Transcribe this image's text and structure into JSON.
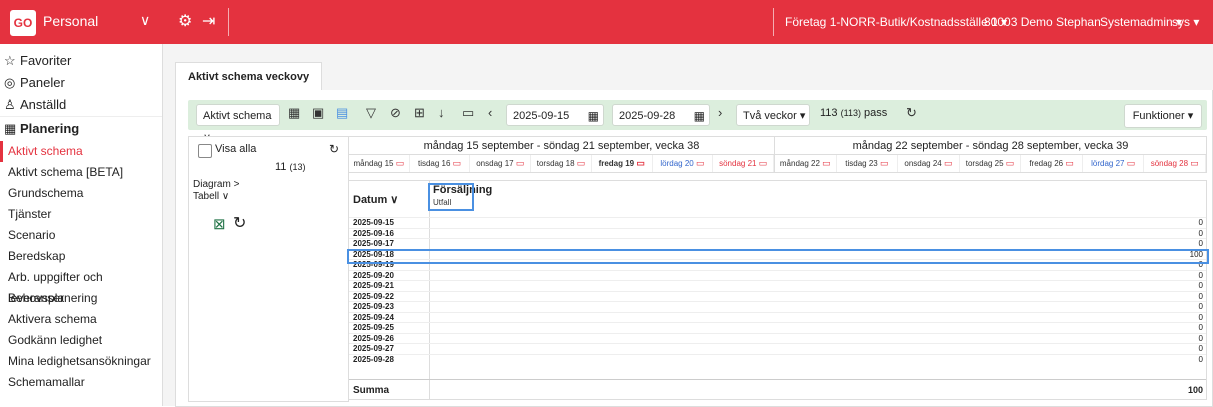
{
  "topbar": {
    "logo": "GO",
    "module": "Personal",
    "company": "Företag 1-NORR-Butik/Kostnadsställe 1 ▾",
    "user": "80003 Demo Stephan",
    "role": "Systemadmin ▾",
    "sys": "sys ▾"
  },
  "sidebar": {
    "top": [
      {
        "label": "Favoriter",
        "icon": "star-icon"
      },
      {
        "label": "Paneler",
        "icon": "dashboard-icon"
      },
      {
        "label": "Anställd",
        "icon": "user-icon"
      }
    ],
    "section": "Planering",
    "items": [
      "Aktivt schema",
      "Aktivt schema [BETA]",
      "Grundschema",
      "Tjänster",
      "Scenario",
      "Beredskap",
      "Arb. uppgifter och leveranser",
      "Behovsplanering",
      "Aktivera schema",
      "Godkänn ledighet",
      "Mina ledighetsansökningar",
      "Schemamallar"
    ]
  },
  "tab": "Aktivt schema veckovy",
  "toolbar": {
    "view_select": "Aktivt schema",
    "date_from": "2025-09-15",
    "date_to": "2025-09-28",
    "period": "Två veckor",
    "pass_count": "113",
    "pass_small": "(113)",
    "pass_label": "pass",
    "functions": "Funktioner"
  },
  "left": {
    "visa_alla": "Visa alla",
    "count": "11",
    "count_small": "(13)",
    "diagram": "Diagram >",
    "tabell": "Tabell ∨"
  },
  "weeks": [
    "måndag 15 september - söndag 21 september, vecka 38",
    "måndag 22 september - söndag 28 september, vecka 39"
  ],
  "days": [
    {
      "label": "måndag 15",
      "type": "normal"
    },
    {
      "label": "tisdag 16",
      "type": "normal"
    },
    {
      "label": "onsdag 17",
      "type": "normal"
    },
    {
      "label": "torsdag 18",
      "type": "normal"
    },
    {
      "label": "fredag 19",
      "type": "bold"
    },
    {
      "label": "lördag 20",
      "type": "sat"
    },
    {
      "label": "söndag 21",
      "type": "sun"
    },
    {
      "label": "måndag 22",
      "type": "normal"
    },
    {
      "label": "tisdag 23",
      "type": "normal"
    },
    {
      "label": "onsdag 24",
      "type": "normal"
    },
    {
      "label": "torsdag 25",
      "type": "normal"
    },
    {
      "label": "fredag 26",
      "type": "normal"
    },
    {
      "label": "lördag 27",
      "type": "sat"
    },
    {
      "label": "söndag 28",
      "type": "sun"
    }
  ],
  "table": {
    "datum_header": "Datum",
    "col_header": "Försäljning",
    "col_sub": "Utfall",
    "rows": [
      {
        "date": "2025-09-15",
        "value": "0"
      },
      {
        "date": "2025-09-16",
        "value": "0"
      },
      {
        "date": "2025-09-17",
        "value": "0"
      },
      {
        "date": "2025-09-18",
        "value": "100"
      },
      {
        "date": "2025-09-19",
        "value": "0"
      },
      {
        "date": "2025-09-20",
        "value": "0"
      },
      {
        "date": "2025-09-21",
        "value": "0"
      },
      {
        "date": "2025-09-22",
        "value": "0"
      },
      {
        "date": "2025-09-23",
        "value": "0"
      },
      {
        "date": "2025-09-24",
        "value": "0"
      },
      {
        "date": "2025-09-25",
        "value": "0"
      },
      {
        "date": "2025-09-26",
        "value": "0"
      },
      {
        "date": "2025-09-27",
        "value": "0"
      },
      {
        "date": "2025-09-28",
        "value": "0"
      }
    ],
    "summa_label": "Summa",
    "summa_value": "100"
  }
}
